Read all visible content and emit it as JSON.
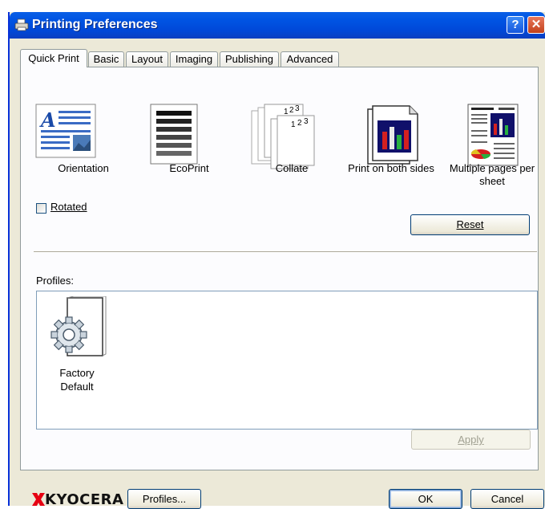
{
  "window": {
    "title": "Printing Preferences"
  },
  "tabs": [
    {
      "label": "Quick Print",
      "active": true
    },
    {
      "label": "Basic"
    },
    {
      "label": "Layout"
    },
    {
      "label": "Imaging"
    },
    {
      "label": "Publishing"
    },
    {
      "label": "Advanced"
    }
  ],
  "quick_options": [
    {
      "label": "Orientation",
      "icon": "orientation-icon"
    },
    {
      "label": "EcoPrint",
      "icon": "ecoprint-icon"
    },
    {
      "label": "Collate",
      "icon": "collate-icon"
    },
    {
      "label": "Print on both sides",
      "icon": "duplex-icon"
    },
    {
      "label": "Multiple pages per sheet",
      "icon": "multiple-pages-icon"
    }
  ],
  "rotated": {
    "label": "Rotated",
    "checked": false
  },
  "reset_label": "Reset",
  "profiles": {
    "label": "Profiles:",
    "items": [
      {
        "name": "Factory Default",
        "icon": "profile-gear-icon"
      }
    ]
  },
  "apply_label": "Apply",
  "footer": {
    "brand": "KYOCERA",
    "profiles_button": "Profiles...",
    "ok_label": "OK",
    "cancel_label": "Cancel"
  },
  "colors": {
    "titlebar": "#0054e3",
    "dialog": "#ece9d8",
    "panel": "#fcfcfe",
    "brand_red": "#e60012"
  }
}
